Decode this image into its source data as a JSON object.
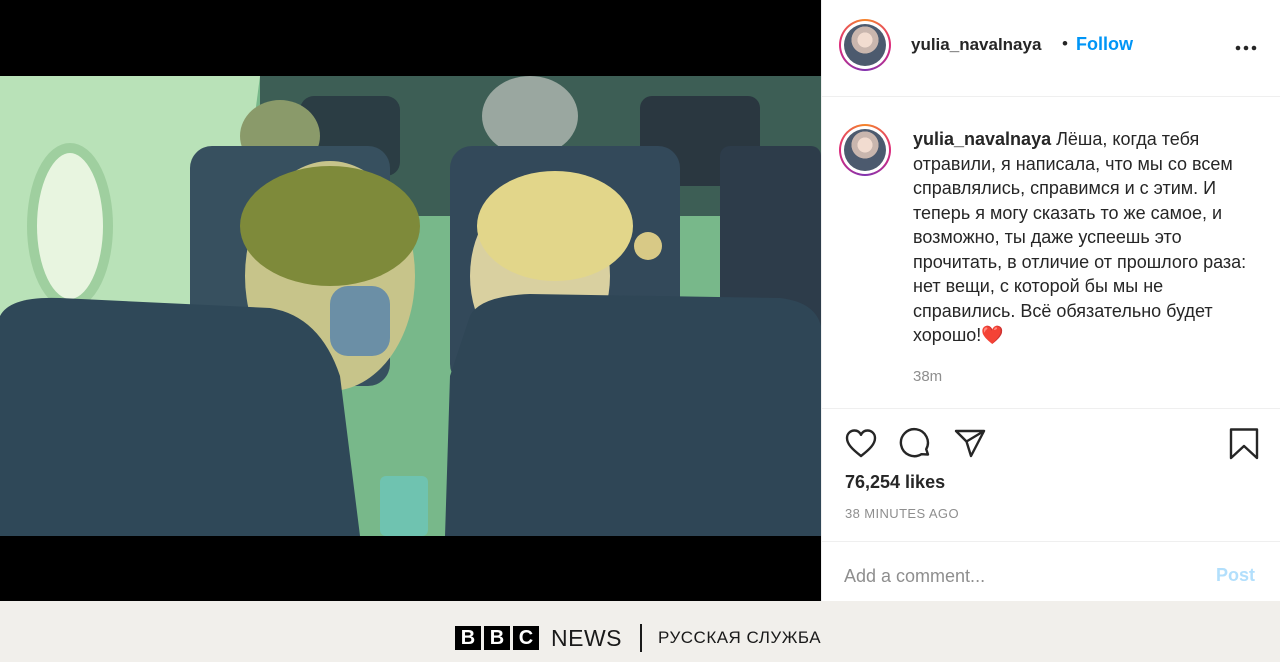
{
  "post": {
    "username": "yulia_navalnaya",
    "separator": "•",
    "follow_label": "Follow",
    "more_icon": "more-horizontal-icon",
    "caption": {
      "username": "yulia_navalnaya",
      "text": "Лёша, когда тебя отравили, я написала, что мы со всем справлялись, справимся и с этим. И теперь я могу сказать то же самое, и возможно, ты даже успеешь это прочитать, в отличие от прошлого раза: нет вещи, с которой бы мы не справились. Всё обязательно будет хорошо!",
      "emoji": "❤️",
      "time_ago": "38m"
    },
    "actions": {
      "like_icon": "heart-icon",
      "comment_icon": "comment-bubble-icon",
      "share_icon": "paper-plane-icon",
      "save_icon": "bookmark-icon"
    },
    "likes": "76,254 likes",
    "date": "38 MINUTES AGO",
    "comment_placeholder": "Add a comment...",
    "post_label": "Post"
  },
  "colors": {
    "follow": "#0095f6",
    "post_disabled": "#b2dffc",
    "muted_text": "#8e8e8e",
    "primary_text": "#262626"
  },
  "footer": {
    "brand_letters": [
      "B",
      "B",
      "C"
    ],
    "news_label": "NEWS",
    "separator": "|",
    "service": "РУССКАЯ СЛУЖБА"
  }
}
